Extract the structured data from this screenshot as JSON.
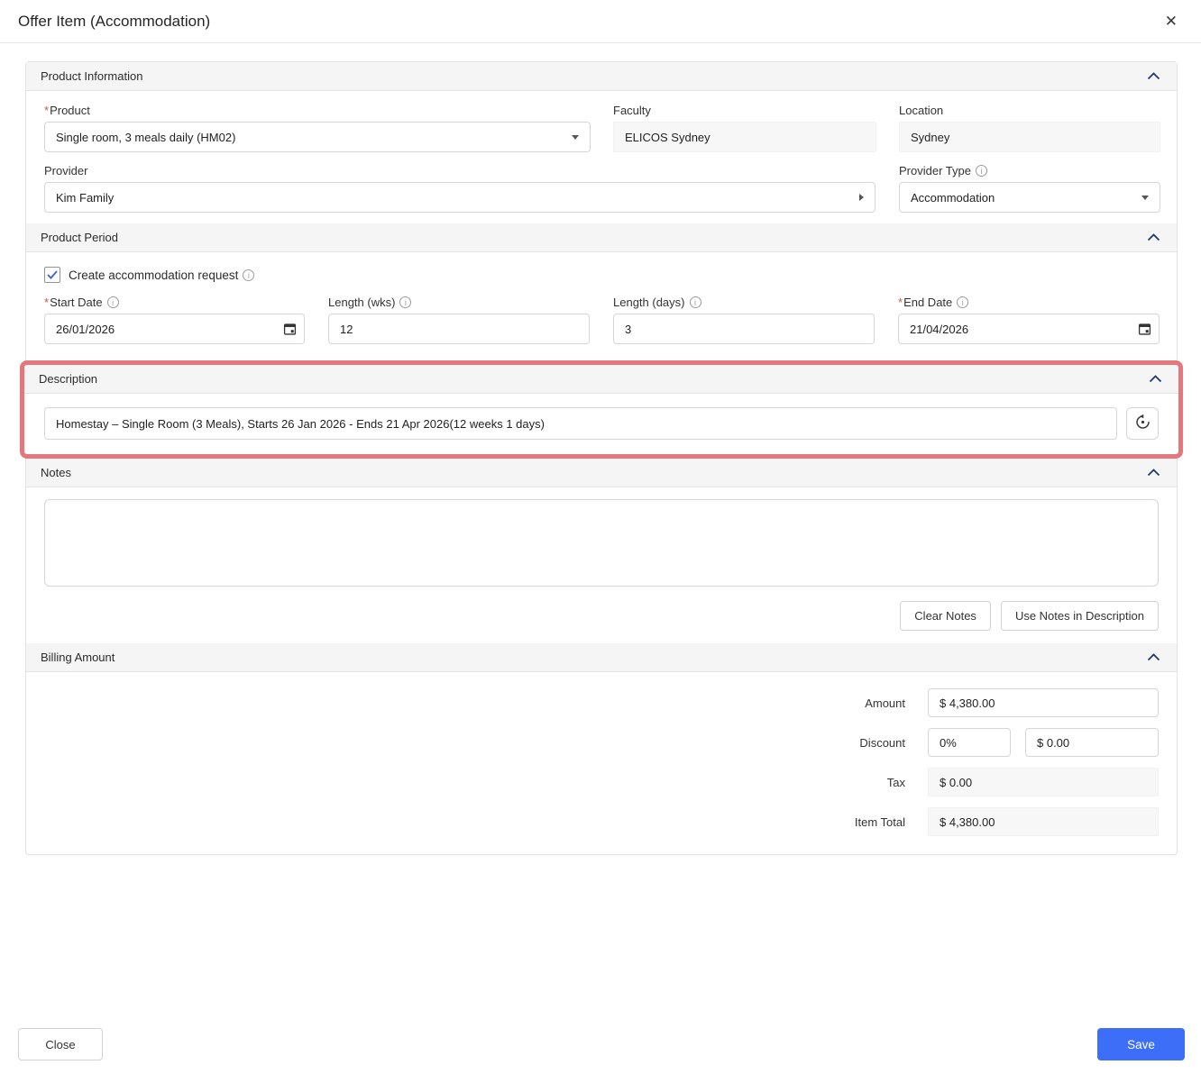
{
  "icons": {
    "close": "✕",
    "info": "i"
  },
  "dialog": {
    "title": "Offer Item (Accommodation)"
  },
  "product_information": {
    "title": "Product Information",
    "product": {
      "label": "Product",
      "required_mark": "*",
      "value": "Single room, 3 meals daily (HM02)"
    },
    "faculty": {
      "label": "Faculty",
      "value": "ELICOS Sydney"
    },
    "location": {
      "label": "Location",
      "value": "Sydney"
    },
    "provider": {
      "label": "Provider",
      "value": "Kim Family"
    },
    "provider_type": {
      "label": "Provider Type",
      "value": "Accommodation"
    }
  },
  "product_period": {
    "title": "Product Period",
    "create_request": {
      "label": "Create accommodation request",
      "checked": true
    },
    "start_date": {
      "label": "Start Date",
      "required_mark": "*",
      "value": "26/01/2026"
    },
    "length_wks": {
      "label": "Length (wks)",
      "value": "12"
    },
    "length_days": {
      "label": "Length (days)",
      "value": "3"
    },
    "end_date": {
      "label": "End Date",
      "required_mark": "*",
      "value": "21/04/2026"
    }
  },
  "description": {
    "title": "Description",
    "value": "Homestay – Single Room (3 Meals), Starts 26 Jan 2026 - Ends 21 Apr 2026(12 weeks 1 days)",
    "highlight_color": "#e5767b"
  },
  "notes": {
    "title": "Notes",
    "value": "",
    "clear_label": "Clear Notes",
    "use_in_description_label": "Use Notes in Description"
  },
  "billing": {
    "title": "Billing Amount",
    "amount": {
      "label": "Amount",
      "value": "$ 4,380.00"
    },
    "discount": {
      "label": "Discount",
      "percent": "0%",
      "amount": "$ 0.00"
    },
    "tax": {
      "label": "Tax",
      "value": "$ 0.00"
    },
    "item_total": {
      "label": "Item Total",
      "value": "$ 4,380.00"
    }
  },
  "footer": {
    "close_label": "Close",
    "save_label": "Save"
  },
  "colors": {
    "primary_blue": "#3d6ef7",
    "highlight_red": "#e5767b",
    "chevron_navy": "#1e3a6e",
    "required_red": "#d0544e",
    "section_header_bg": "#f5f5f5"
  }
}
